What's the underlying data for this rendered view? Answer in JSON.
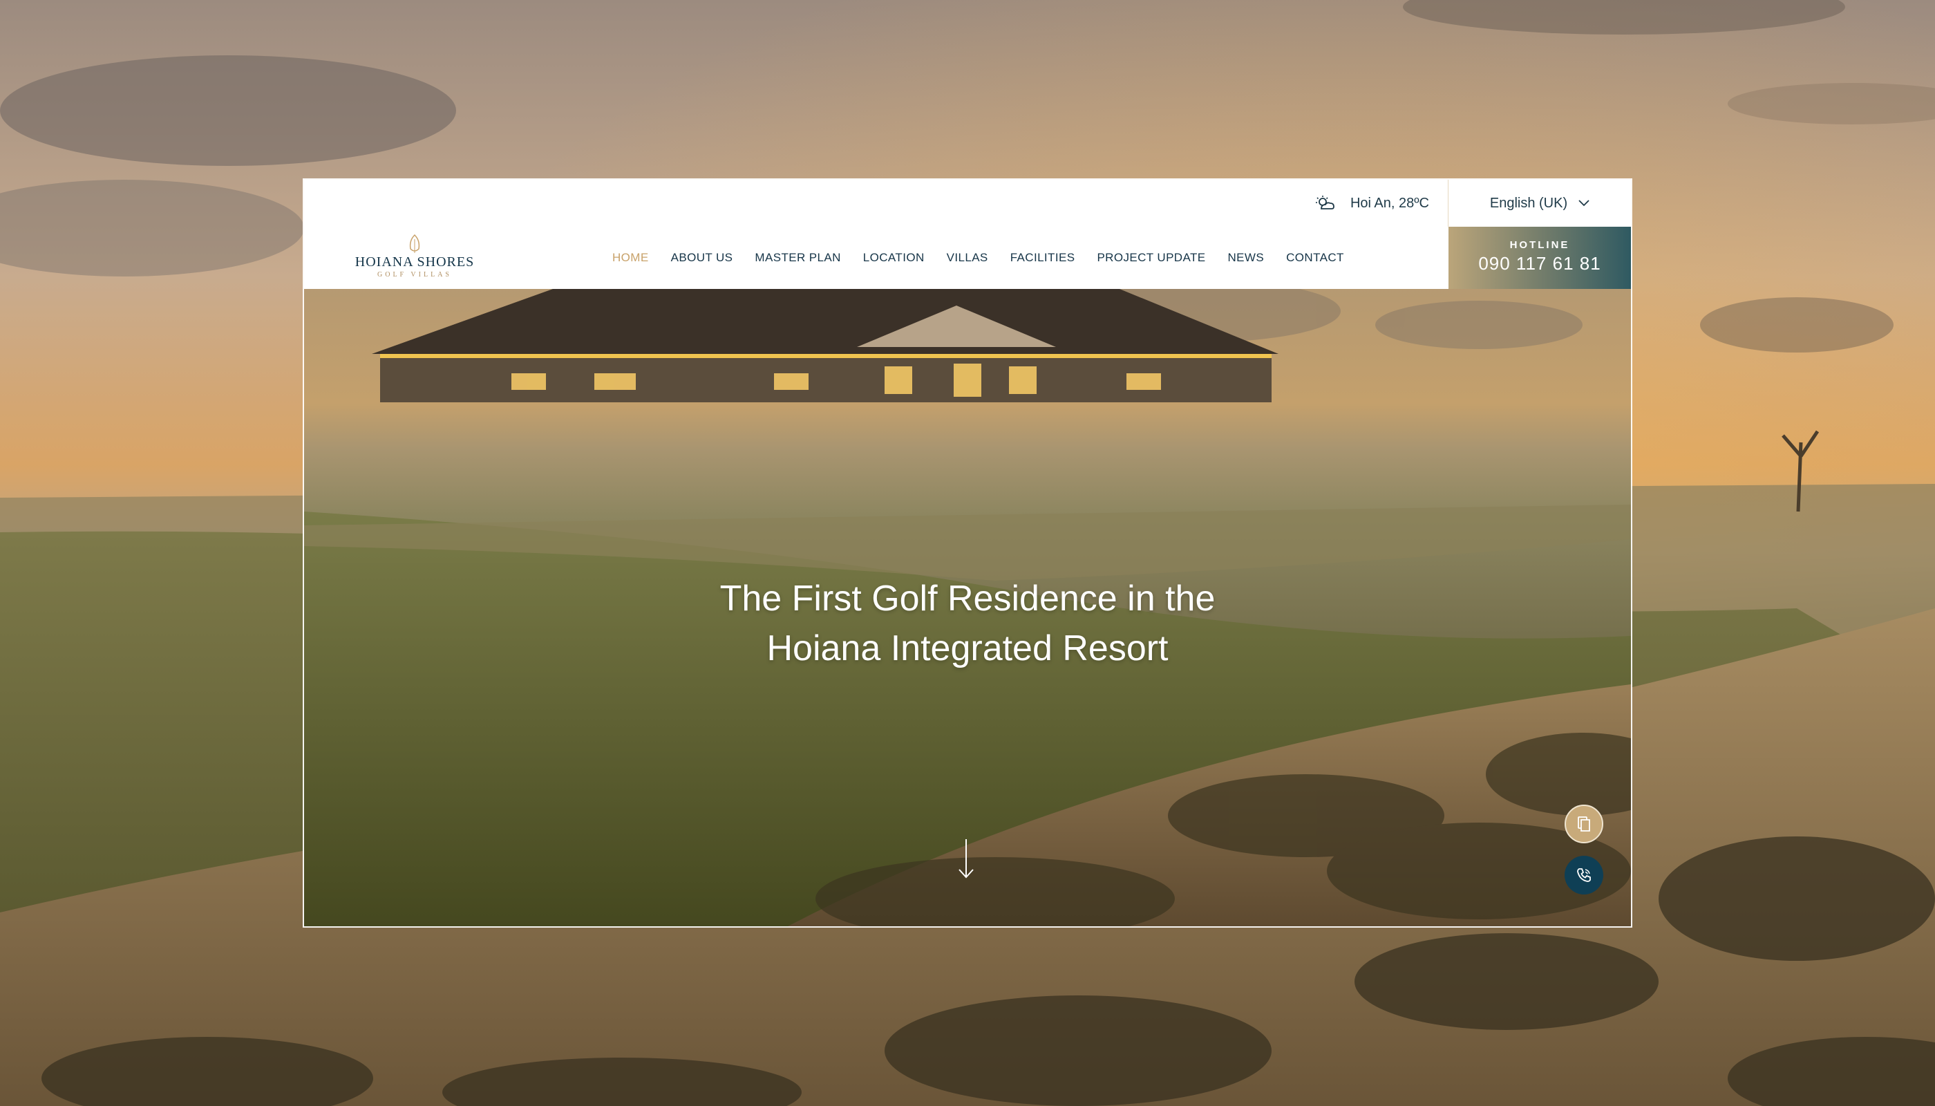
{
  "topbar": {
    "weather_text": "Hoi An, 28ºC",
    "weather_icon": "partly-cloudy-icon",
    "language": "English (UK)"
  },
  "logo": {
    "name": "HOIANA SHORES",
    "sub": "GOLF VILLAS"
  },
  "nav": {
    "items": [
      "HOME",
      "ABOUT US",
      "MASTER PLAN",
      "LOCATION",
      "VILLAS",
      "FACILITIES",
      "PROJECT UPDATE",
      "NEWS",
      "CONTACT"
    ],
    "active_index": 0
  },
  "hotline": {
    "label": "HOTLINE",
    "number": "090 117 61 81"
  },
  "hero": {
    "title_line1": "The First Golf Residence in the",
    "title_line2": "Hoiana Integrated Resort"
  },
  "floating_buttons": [
    "document-icon",
    "phone-icon"
  ],
  "colors": {
    "accent_gold": "#c8a26a",
    "navy": "#173548",
    "hotline_gradient_end": "#2f5a62",
    "phone_button": "#0f3f55"
  }
}
